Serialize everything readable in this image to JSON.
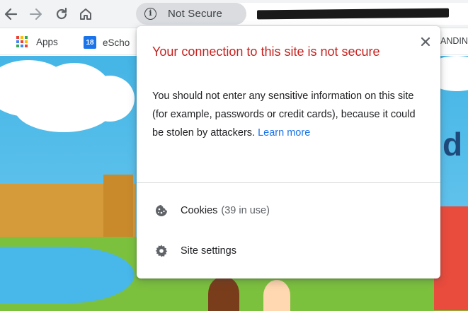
{
  "toolbar": {
    "security_chip": "Not Secure",
    "icons": [
      "back-icon",
      "forward-icon",
      "reload-icon",
      "home-icon",
      "info-icon"
    ]
  },
  "bookmarks": {
    "apps_label": "Apps",
    "eschool_label": "eScho",
    "calendar_badge": "18",
    "truncated_right": "ANDIN"
  },
  "page": {
    "heading_fragment": "d"
  },
  "popup": {
    "title": "Your connection to this site is not secure",
    "body": "You should not enter any sensitive information on this site (for example, passwords or credit cards), because it could be stolen by attackers. ",
    "link": "Learn more",
    "close_label": "×",
    "items": [
      {
        "label": "Cookies",
        "count": "(39 in use)",
        "icon": "cookie-icon"
      },
      {
        "label": "Site settings",
        "icon": "gear-icon"
      }
    ]
  },
  "colors": {
    "warning": "#c5221f",
    "link": "#1a73e8",
    "chip": "#dadce0"
  }
}
